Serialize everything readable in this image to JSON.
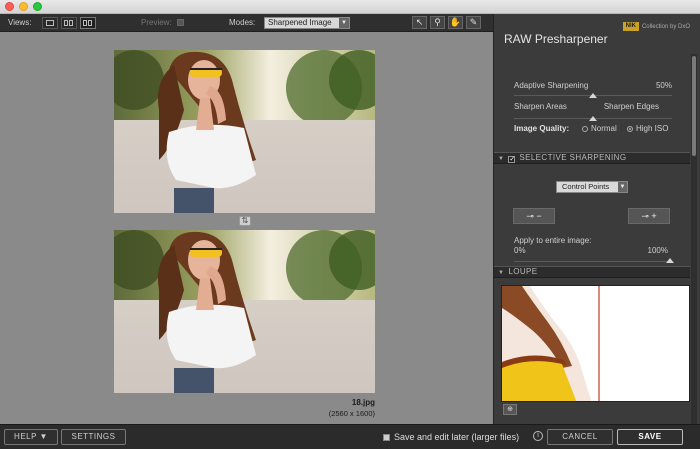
{
  "toolbar": {
    "views_label": "Views:",
    "preview_label": "Preview:",
    "modes_label": "Modes:",
    "mode_value": "Sharpened Image",
    "tools": [
      "pointer-icon",
      "zoom-icon",
      "hand-icon",
      "eyedropper-icon"
    ]
  },
  "canvas": {
    "filename": "18.jpg",
    "dimensions": "(2560 x 1600)"
  },
  "panel": {
    "logo_badge": "NIK",
    "logo_text": "Collection by DxO",
    "title": "RAW Presharpener",
    "adaptive_label": "Adaptive Sharpening",
    "adaptive_value": "50%",
    "adaptive_level": 0.5,
    "areas_left": "Sharpen Areas",
    "areas_right": "Sharpen Edges",
    "image_quality_label": "Image Quality:",
    "quality_normal": "Normal",
    "quality_high": "High ISO",
    "selective_header": "SELECTIVE SHARPENING",
    "control_points": "Control Points",
    "apply_label": "Apply to entire image:",
    "apply_min": "0%",
    "apply_max": "100%",
    "apply_level": 1.0,
    "loupe_header": "LOUPE"
  },
  "bottom": {
    "help": "HELP ▼",
    "settings": "SETTINGS",
    "save_later": "Save and edit later (larger files)",
    "cancel": "CANCEL",
    "save": "SAVE"
  },
  "colors": {
    "canvas_bg": "#8a8a8a",
    "panel_bg": "#3b3b3b",
    "loupe_line": "#c0392b"
  }
}
